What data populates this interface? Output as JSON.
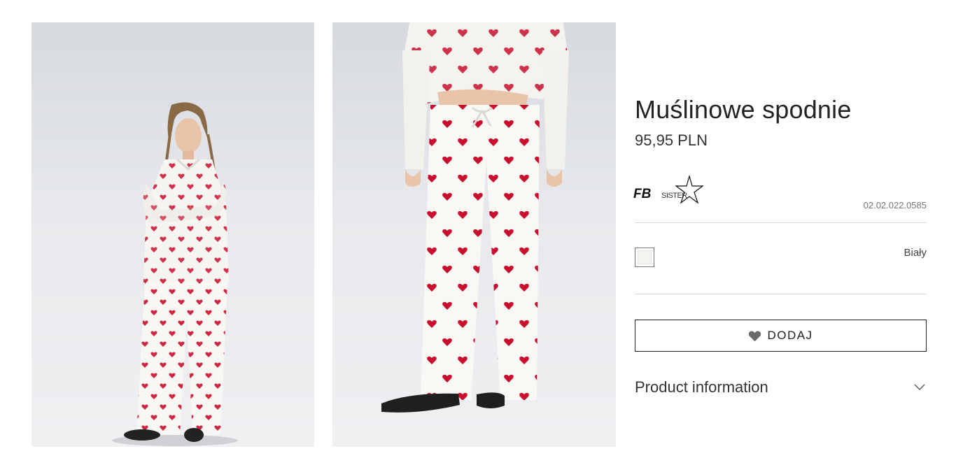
{
  "gallery": {
    "images": [
      {
        "alt": "model-full-body"
      },
      {
        "alt": "model-pants-closeup"
      }
    ]
  },
  "product": {
    "title": "Muślinowe spodnie",
    "price": "95,95 PLN",
    "brand": {
      "logo_text_main": "FB",
      "logo_text_sub": "SISTER"
    },
    "sku": "02.02.022.0585",
    "color": {
      "name": "Biały",
      "swatch_hex": "#f3f3f0"
    }
  },
  "actions": {
    "add_label": "DODAJ",
    "add_icon": "heart-icon"
  },
  "accordion": {
    "label": "Product information",
    "icon": "chevron-down-icon"
  }
}
